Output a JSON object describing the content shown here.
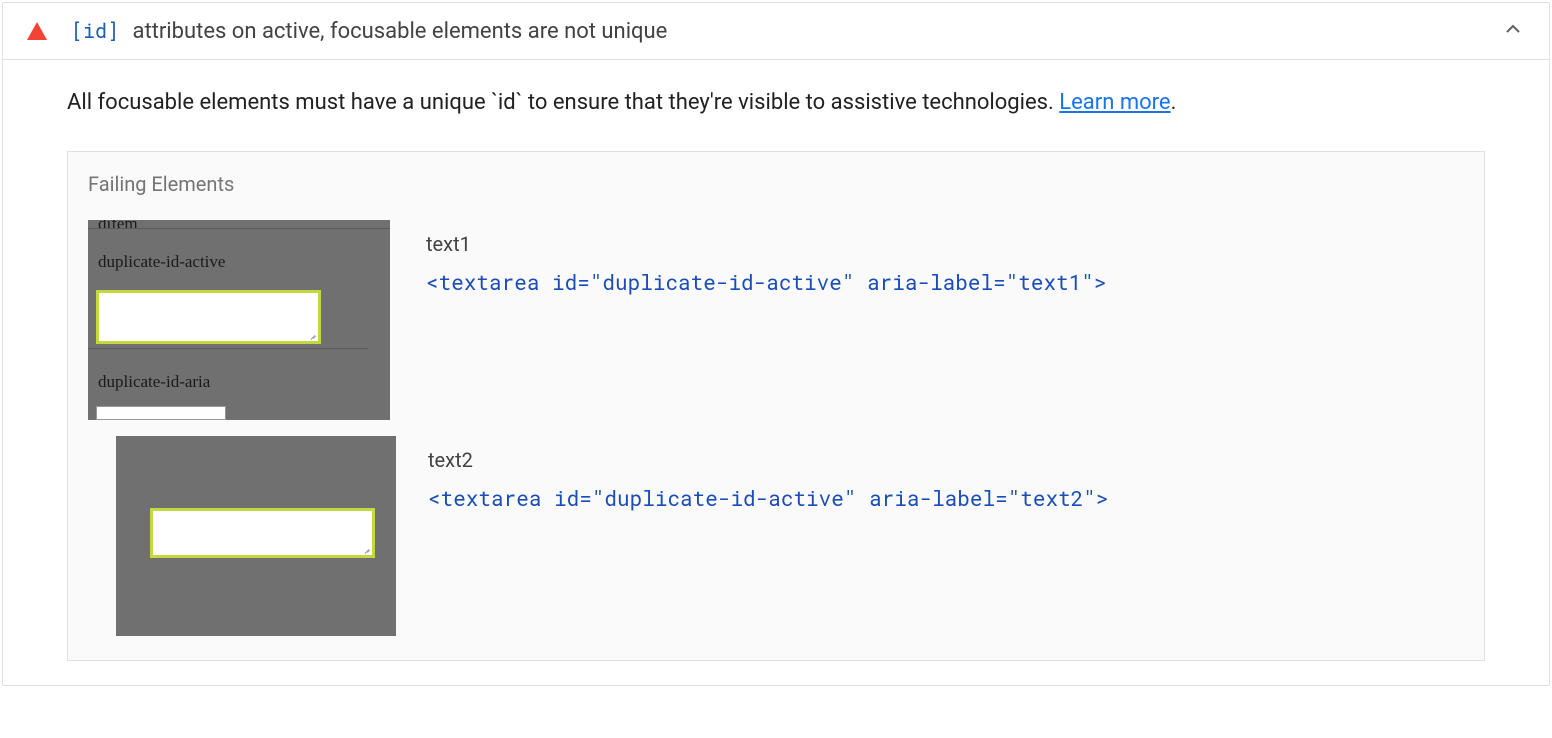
{
  "header": {
    "code_badge": "[id]",
    "title_text": " attributes on active, focusable elements are not unique"
  },
  "description": {
    "text": "All focusable elements must have a unique `id` to ensure that they're visible to assistive technologies. ",
    "learn_more": "Learn more"
  },
  "failing": {
    "section_title": "Failing Elements",
    "items": [
      {
        "label": "text1",
        "code": "<textarea id=\"duplicate-id-active\" aria-label=\"text1\">",
        "thumb_texts": {
          "top": "difem",
          "mid": "duplicate-id-active",
          "bot": "duplicate-id-aria"
        }
      },
      {
        "label": "text2",
        "code": "<textarea id=\"duplicate-id-active\" aria-label=\"text2\">"
      }
    ]
  }
}
